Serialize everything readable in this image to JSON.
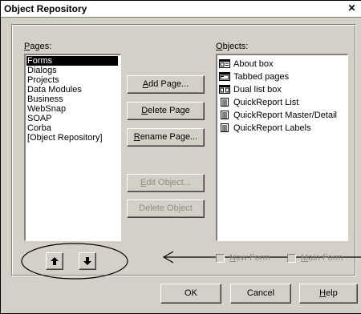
{
  "window": {
    "title": "Object Repository",
    "close_glyph": "✕"
  },
  "pages": {
    "label_mnemonic": "P",
    "label_rest": "ages:",
    "items": [
      "Forms",
      "Dialogs",
      "Projects",
      "Data Modules",
      "Business",
      "WebSnap",
      "SOAP",
      "Corba",
      "[Object Repository]"
    ],
    "selected": "Forms"
  },
  "objects": {
    "label_mnemonic": "O",
    "label_rest": "bjects:",
    "items": [
      {
        "label": "About box",
        "icon": "form-icon"
      },
      {
        "label": "Tabbed pages",
        "icon": "form-icon"
      },
      {
        "label": "Dual list box",
        "icon": "form-icon"
      },
      {
        "label": "QuickReport List",
        "icon": "report-icon"
      },
      {
        "label": "QuickReport Master/Detail",
        "icon": "report-icon"
      },
      {
        "label": "QuickReport Labels",
        "icon": "report-icon"
      }
    ]
  },
  "buttons": {
    "add_page": {
      "mn": "A",
      "rest": "dd Page..."
    },
    "delete_page": {
      "mn": "D",
      "rest": "elete Page"
    },
    "rename_page": {
      "mn": "R",
      "rest": "ename Page..."
    },
    "edit_object": {
      "mn": "E",
      "rest": "dit Object..."
    },
    "delete_object": {
      "text": "Delete Object"
    },
    "ok": "OK",
    "cancel": "Cancel",
    "help": {
      "mn": "H",
      "rest": "elp"
    }
  },
  "arrows": {
    "up_icon": "arrow-up-icon",
    "down_icon": "arrow-down-icon"
  },
  "checkboxes": {
    "new_form": {
      "mn": "N",
      "rest": "ew Form",
      "checked": false,
      "enabled": false
    },
    "main_form": {
      "mn": "M",
      "rest": "ain Form",
      "checked": false,
      "enabled": false
    }
  },
  "colors": {
    "face": "#d4d0c8",
    "selection": "#000000",
    "disabled_text": "#8e8c88"
  }
}
